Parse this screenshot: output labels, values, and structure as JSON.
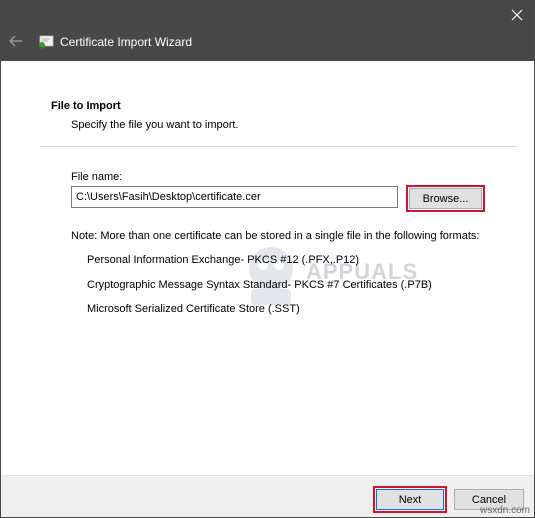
{
  "window": {
    "title": "Certificate Import Wizard",
    "icons": {
      "close": "close-icon",
      "back": "back-arrow-icon",
      "app": "certificate-icon"
    }
  },
  "page": {
    "heading": "File to Import",
    "description": "Specify the file you want to import."
  },
  "file": {
    "label": "File name:",
    "value": "C:\\Users\\Fasih\\Desktop\\certificate.cer",
    "browse_label": "Browse..."
  },
  "note": {
    "text": "Note:  More than one certificate can be stored in a single file in the following formats:",
    "formats": [
      "Personal Information Exchange- PKCS #12 (.PFX,.P12)",
      "Cryptographic Message Syntax Standard- PKCS #7 Certificates (.P7B)",
      "Microsoft Serialized Certificate Store (.SST)"
    ]
  },
  "footer": {
    "next_label": "Next",
    "cancel_label": "Cancel"
  },
  "watermark": {
    "text": "APPUALS"
  },
  "site_label": "wsxdn.com",
  "colors": {
    "titlebar": "#484848",
    "highlight": "#d6122c",
    "button_face": "#e1e1e1",
    "footer": "#f0f0f0"
  }
}
